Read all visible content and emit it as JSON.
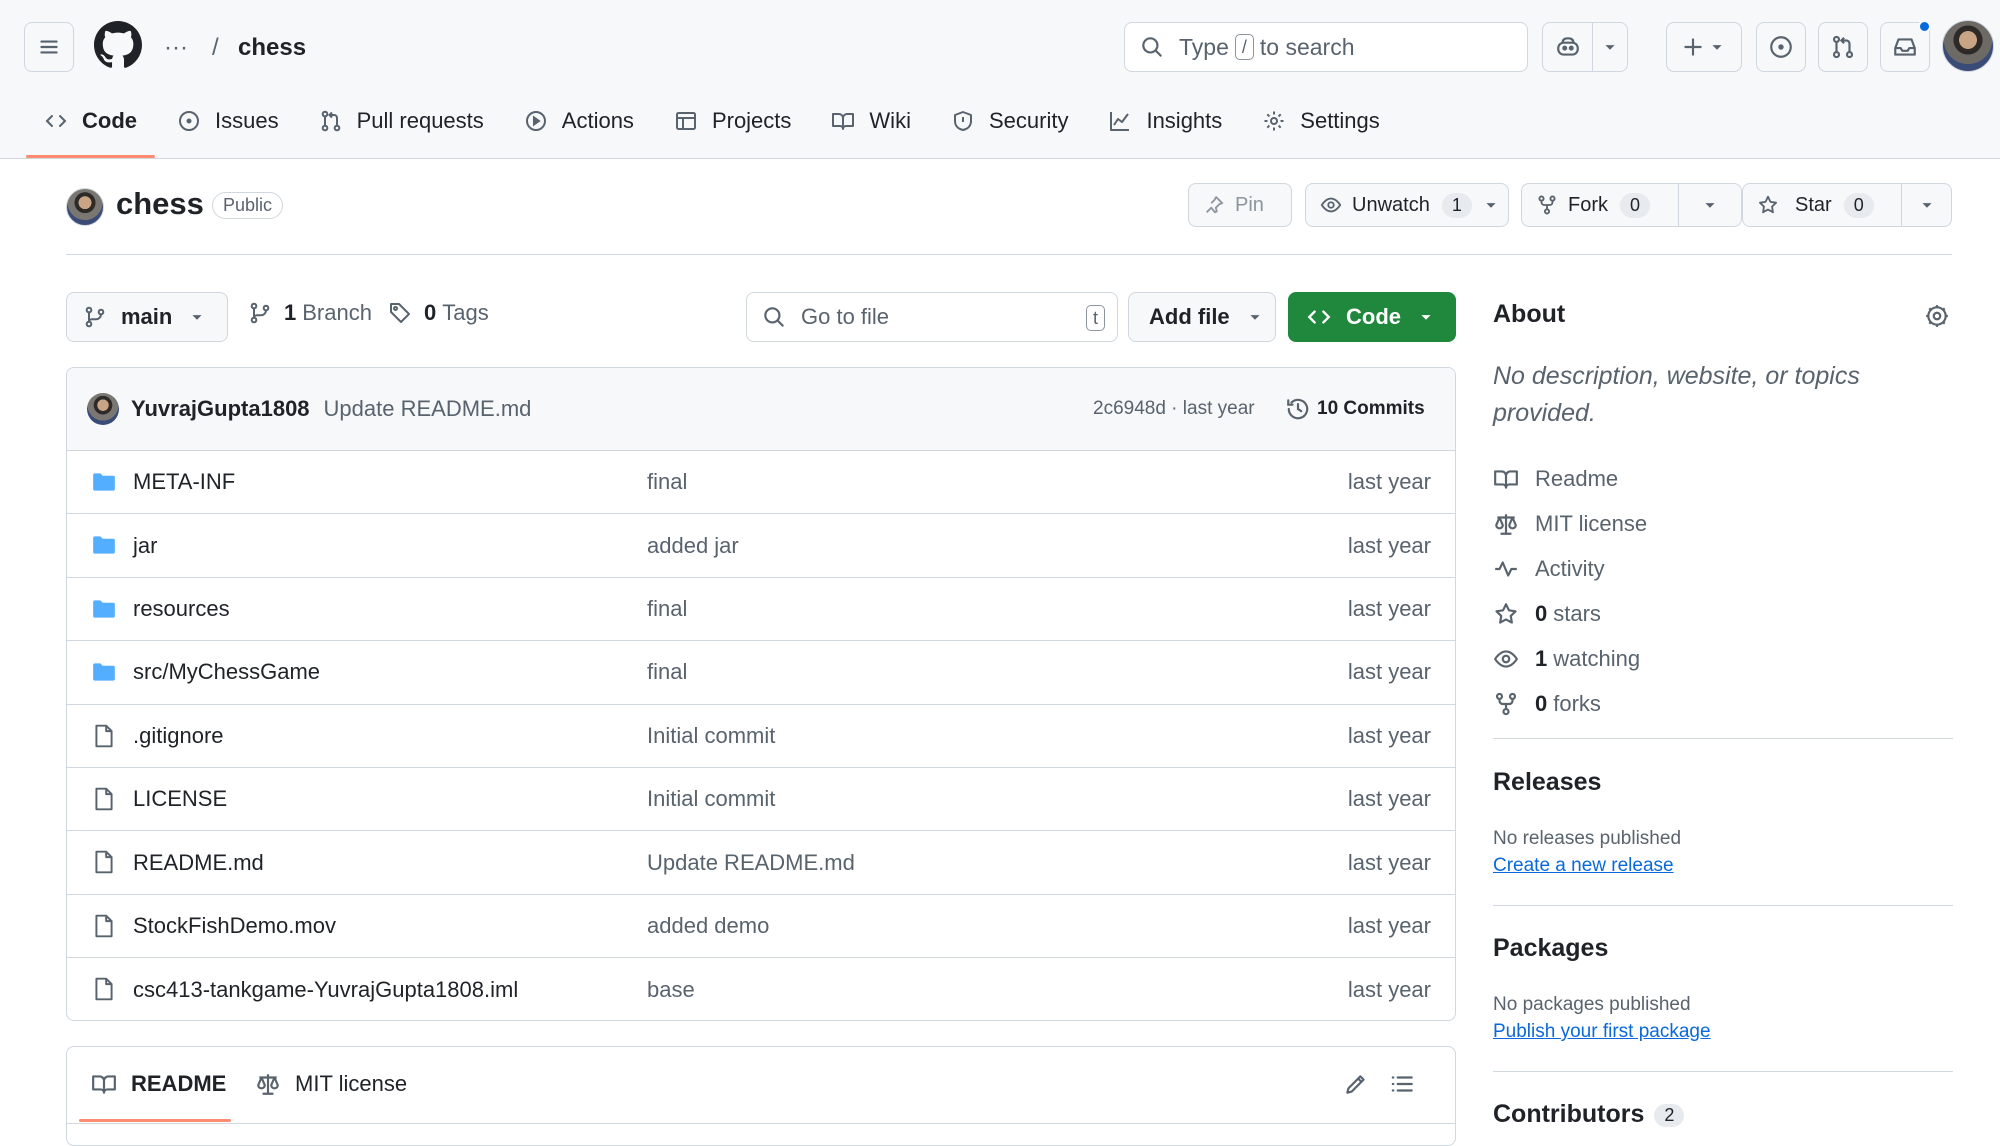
{
  "header": {
    "menu_icon": "hamburger-icon",
    "logo": "github-logo",
    "ellipsis": "···",
    "separator": "/",
    "repo": "chess",
    "search": {
      "pre": "Type",
      "key": "/",
      "post": "to search"
    }
  },
  "nav_tabs": [
    {
      "label": "Code",
      "icon": "code-icon",
      "active": true
    },
    {
      "label": "Issues",
      "icon": "issue-icon"
    },
    {
      "label": "Pull requests",
      "icon": "pull-request-icon"
    },
    {
      "label": "Actions",
      "icon": "play-icon"
    },
    {
      "label": "Projects",
      "icon": "table-icon"
    },
    {
      "label": "Wiki",
      "icon": "book-icon"
    },
    {
      "label": "Security",
      "icon": "shield-icon"
    },
    {
      "label": "Insights",
      "icon": "graph-icon"
    },
    {
      "label": "Settings",
      "icon": "gear-icon"
    }
  ],
  "repo": {
    "name": "chess",
    "visibility": "Public",
    "pin_label": "Pin",
    "watch_label": "Unwatch",
    "watch_count": "1",
    "fork_label": "Fork",
    "fork_count": "0",
    "star_label": "Star",
    "star_count": "0"
  },
  "filenav": {
    "branch": "main",
    "branches_count": "1",
    "branches_label": "Branch",
    "tags_count": "0",
    "tags_label": "Tags",
    "goto_placeholder": "Go to file",
    "goto_key": "t",
    "add_file": "Add file",
    "code": "Code"
  },
  "last_commit": {
    "author": "YuvrajGupta1808",
    "message": "Update README.md",
    "sha_time": "2c6948d · last year",
    "commits": "10 Commits"
  },
  "files": [
    {
      "type": "folder",
      "name": "META-INF",
      "message": "final",
      "date": "last year"
    },
    {
      "type": "folder",
      "name": "jar",
      "message": "added jar",
      "date": "last year"
    },
    {
      "type": "folder",
      "name": "resources",
      "message": "final",
      "date": "last year"
    },
    {
      "type": "folder",
      "name": "src/MyChessGame",
      "message": "final",
      "date": "last year"
    },
    {
      "type": "file",
      "name": ".gitignore",
      "message": "Initial commit",
      "date": "last year"
    },
    {
      "type": "file",
      "name": "LICENSE",
      "message": "Initial commit",
      "date": "last year"
    },
    {
      "type": "file",
      "name": "README.md",
      "message": "Update README.md",
      "date": "last year"
    },
    {
      "type": "file",
      "name": "StockFishDemo.mov",
      "message": "added demo",
      "date": "last year"
    },
    {
      "type": "file",
      "name": "csc413-tankgame-YuvrajGupta1808.iml",
      "message": "base",
      "date": "last year"
    }
  ],
  "readme_tabs": {
    "readme": "README",
    "license": "MIT license"
  },
  "about": {
    "title": "About",
    "description": "No description, website, or topics provided.",
    "readme": "Readme",
    "license": "MIT license",
    "activity": "Activity",
    "stars_count": "0",
    "stars_label": "stars",
    "watching_count": "1",
    "watching_label": "watching",
    "forks_count": "0",
    "forks_label": "forks"
  },
  "releases": {
    "title": "Releases",
    "none": "No releases published",
    "link": "Create a new release"
  },
  "packages": {
    "title": "Packages",
    "none": "No packages published",
    "link": "Publish your first package"
  },
  "contributors": {
    "title": "Contributors",
    "count": "2"
  },
  "colors": {
    "accent_green": "#1f883d",
    "link_blue": "#0969da",
    "tab_underline": "#fd8c73",
    "folder_blue": "#54aeff"
  }
}
